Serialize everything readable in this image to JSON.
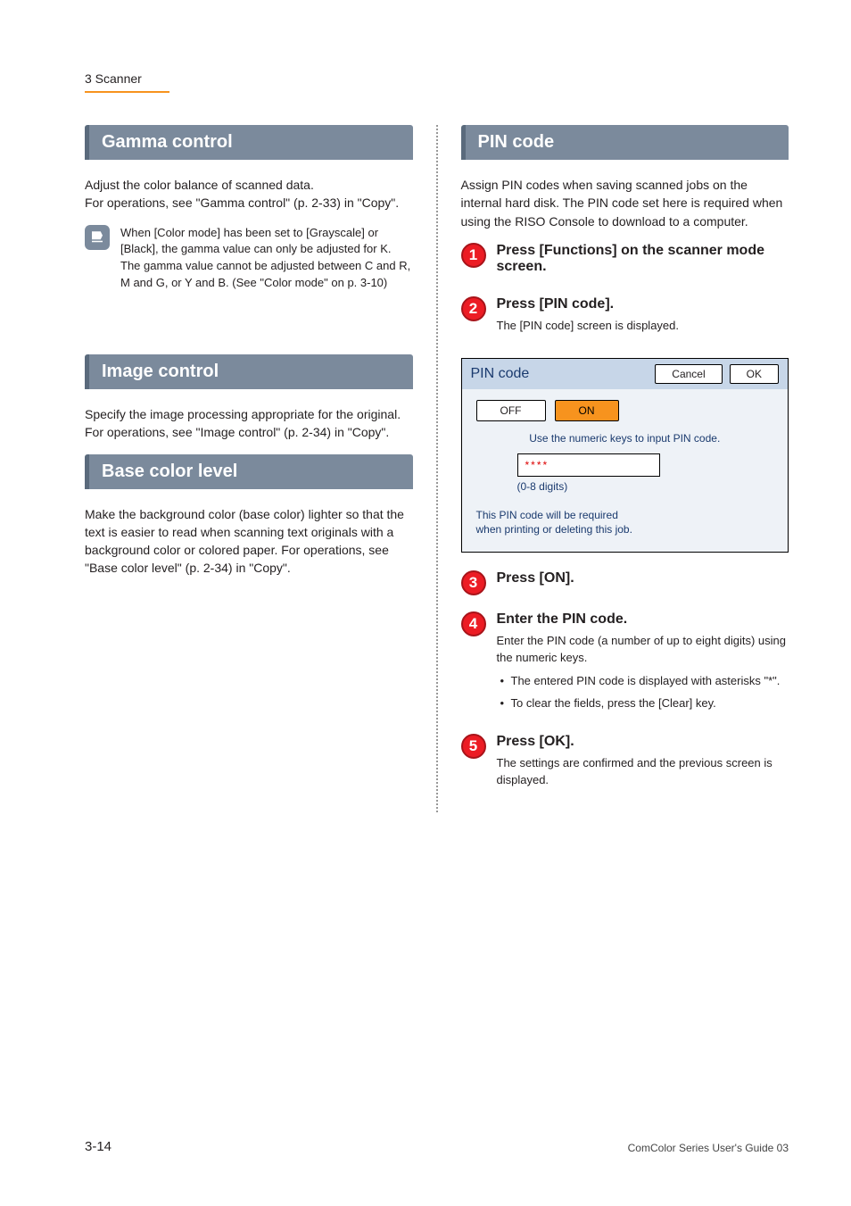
{
  "breadcrumb": "3 Scanner",
  "left": {
    "gamma": {
      "title": "Gamma control",
      "body": "Adjust the color balance of scanned data.\nFor operations, see \"Gamma control\" (p. 2-33) in \"Copy\".",
      "note": "When [Color mode] has been set to [Grayscale] or [Black], the gamma value can only be adjusted for K. The gamma value cannot be adjusted between C and R, M and G, or Y and B. (See \"Color mode\" on p. 3-10)"
    },
    "image": {
      "title": "Image control",
      "body": "Specify the image processing appropriate for the original.\nFor operations, see \"Image control\" (p. 2-34) in \"Copy\"."
    },
    "base": {
      "title": "Base color level",
      "body": "Make the background color (base color) lighter so that the text is easier to read when scanning text originals with a background color or colored paper. For operations, see \"Base color level\" (p. 2-34) in \"Copy\"."
    }
  },
  "right": {
    "pin": {
      "title": "PIN code",
      "intro": "Assign PIN codes when saving scanned jobs on the internal hard disk. The PIN code set here is required when using the RISO Console to download to a computer.",
      "steps": {
        "s1": {
          "num": "1",
          "title": "Press [Functions] on the scanner mode screen."
        },
        "s2": {
          "num": "2",
          "title": "Press [PIN code].",
          "desc": "The [PIN code] screen is displayed.",
          "shot": {
            "title": "PIN code",
            "cancel": "Cancel",
            "ok": "OK",
            "off": "OFF",
            "on": "ON",
            "hint": "Use the numeric keys to input PIN code.",
            "value": "****",
            "range": "(0-8 digits)",
            "note1": "This PIN code will be required",
            "note2": "when printing or deleting this job."
          }
        },
        "s3": {
          "num": "3",
          "title": "Press [ON]."
        },
        "s4": {
          "num": "4",
          "title": "Enter the PIN code.",
          "desc": "Enter the PIN code (a number of up to eight digits) using the numeric keys.",
          "bullets": [
            "The entered PIN code is displayed with asterisks \"*\".",
            "To clear the fields, press the [Clear] key."
          ]
        },
        "s5": {
          "num": "5",
          "title": "Press [OK].",
          "desc": "The settings are confirmed and the previous screen is displayed."
        }
      }
    }
  },
  "pageNumber": "3-14",
  "footer": "ComColor Series User's Guide 03"
}
